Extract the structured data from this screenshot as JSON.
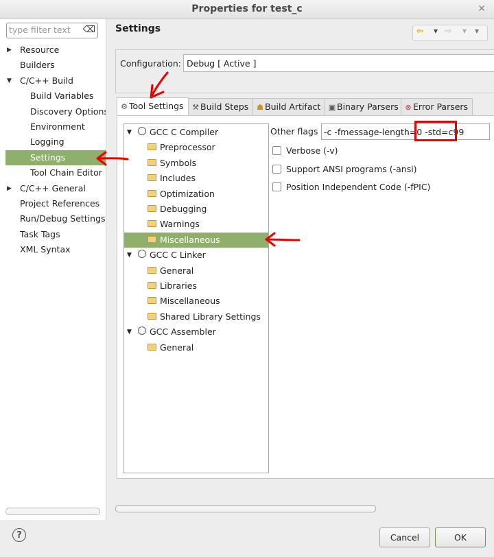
{
  "window": {
    "title": "Properties for test_c",
    "close_icon": "close-icon"
  },
  "filter": {
    "placeholder": "type filter text"
  },
  "nav": {
    "items": [
      {
        "label": "Resource",
        "level": 0,
        "arrow": "collapsed"
      },
      {
        "label": "Builders",
        "level": 0,
        "arrow": "none"
      },
      {
        "label": "C/C++ Build",
        "level": 0,
        "arrow": "expanded"
      },
      {
        "label": "Build Variables",
        "level": 1
      },
      {
        "label": "Discovery Options",
        "level": 1
      },
      {
        "label": "Environment",
        "level": 1
      },
      {
        "label": "Logging",
        "level": 1
      },
      {
        "label": "Settings",
        "level": 1,
        "selected": true
      },
      {
        "label": "Tool Chain Editor",
        "level": 1
      },
      {
        "label": "C/C++ General",
        "level": 0,
        "arrow": "collapsed"
      },
      {
        "label": "Project References",
        "level": 0
      },
      {
        "label": "Run/Debug Settings",
        "level": 0
      },
      {
        "label": "Task Tags",
        "level": 0
      },
      {
        "label": "XML Syntax",
        "level": 0
      }
    ]
  },
  "page": {
    "title": "Settings"
  },
  "configuration": {
    "label": "Configuration:",
    "value": "Debug  [ Active ]"
  },
  "tabs": [
    {
      "label": "Tool Settings",
      "icon": "tool-settings-icon",
      "active": true
    },
    {
      "label": "Build Steps",
      "icon": "build-steps-icon"
    },
    {
      "label": "Build Artifact",
      "icon": "build-artifact-icon"
    },
    {
      "label": "Binary Parsers",
      "icon": "binary-parsers-icon"
    },
    {
      "label": "Error Parsers",
      "icon": "error-parsers-icon"
    }
  ],
  "tool_tree": [
    {
      "label": "GCC C Compiler",
      "level": 0
    },
    {
      "label": "Preprocessor",
      "level": 1
    },
    {
      "label": "Symbols",
      "level": 1
    },
    {
      "label": "Includes",
      "level": 1
    },
    {
      "label": "Optimization",
      "level": 1
    },
    {
      "label": "Debugging",
      "level": 1
    },
    {
      "label": "Warnings",
      "level": 1
    },
    {
      "label": "Miscellaneous",
      "level": 1,
      "selected": true
    },
    {
      "label": "GCC C Linker",
      "level": 0
    },
    {
      "label": "General",
      "level": 1
    },
    {
      "label": "Libraries",
      "level": 1
    },
    {
      "label": "Miscellaneous",
      "level": 1
    },
    {
      "label": "Shared Library Settings",
      "level": 1
    },
    {
      "label": "GCC Assembler",
      "level": 0
    },
    {
      "label": "General",
      "level": 1
    }
  ],
  "options": {
    "other_flags_label": "Other flags",
    "other_flags_value": "-c -fmessage-length=0 -std=c99",
    "checkboxes": [
      {
        "label": "Verbose (-v)",
        "checked": false
      },
      {
        "label": "Support ANSI programs (-ansi)",
        "checked": false
      },
      {
        "label": "Position Independent Code (-fPIC)",
        "checked": false
      }
    ]
  },
  "footer": {
    "help": "?",
    "cancel": "Cancel",
    "ok": "OK"
  },
  "colors": {
    "selection": "#8faf6c",
    "annotation": "#ee0000"
  }
}
